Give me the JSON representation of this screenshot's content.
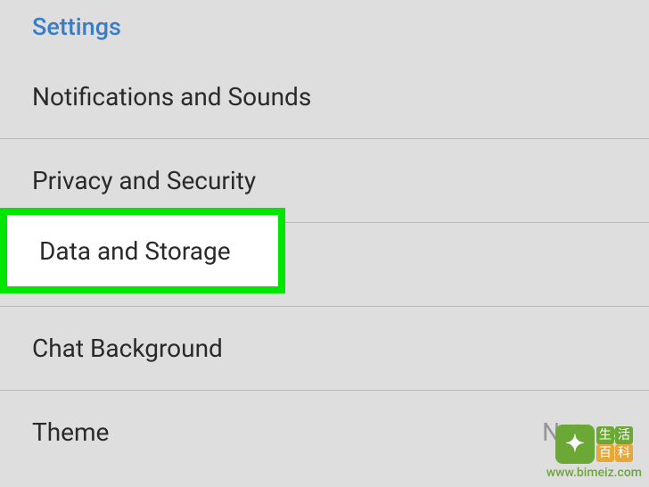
{
  "section_header": "Settings",
  "items": [
    {
      "label": "Notifications and Sounds"
    },
    {
      "label": "Privacy and Security"
    },
    {
      "label": "Data and Storage",
      "highlighted": true
    },
    {
      "label": "Chat Background"
    },
    {
      "label": "Theme",
      "value": "Nature"
    }
  ],
  "highlight_label": "Data and Storage",
  "watermark": {
    "chars_green": [
      "生",
      "活"
    ],
    "chars_orange": [
      "百",
      "科"
    ],
    "url": "www.bimeiz.com"
  }
}
